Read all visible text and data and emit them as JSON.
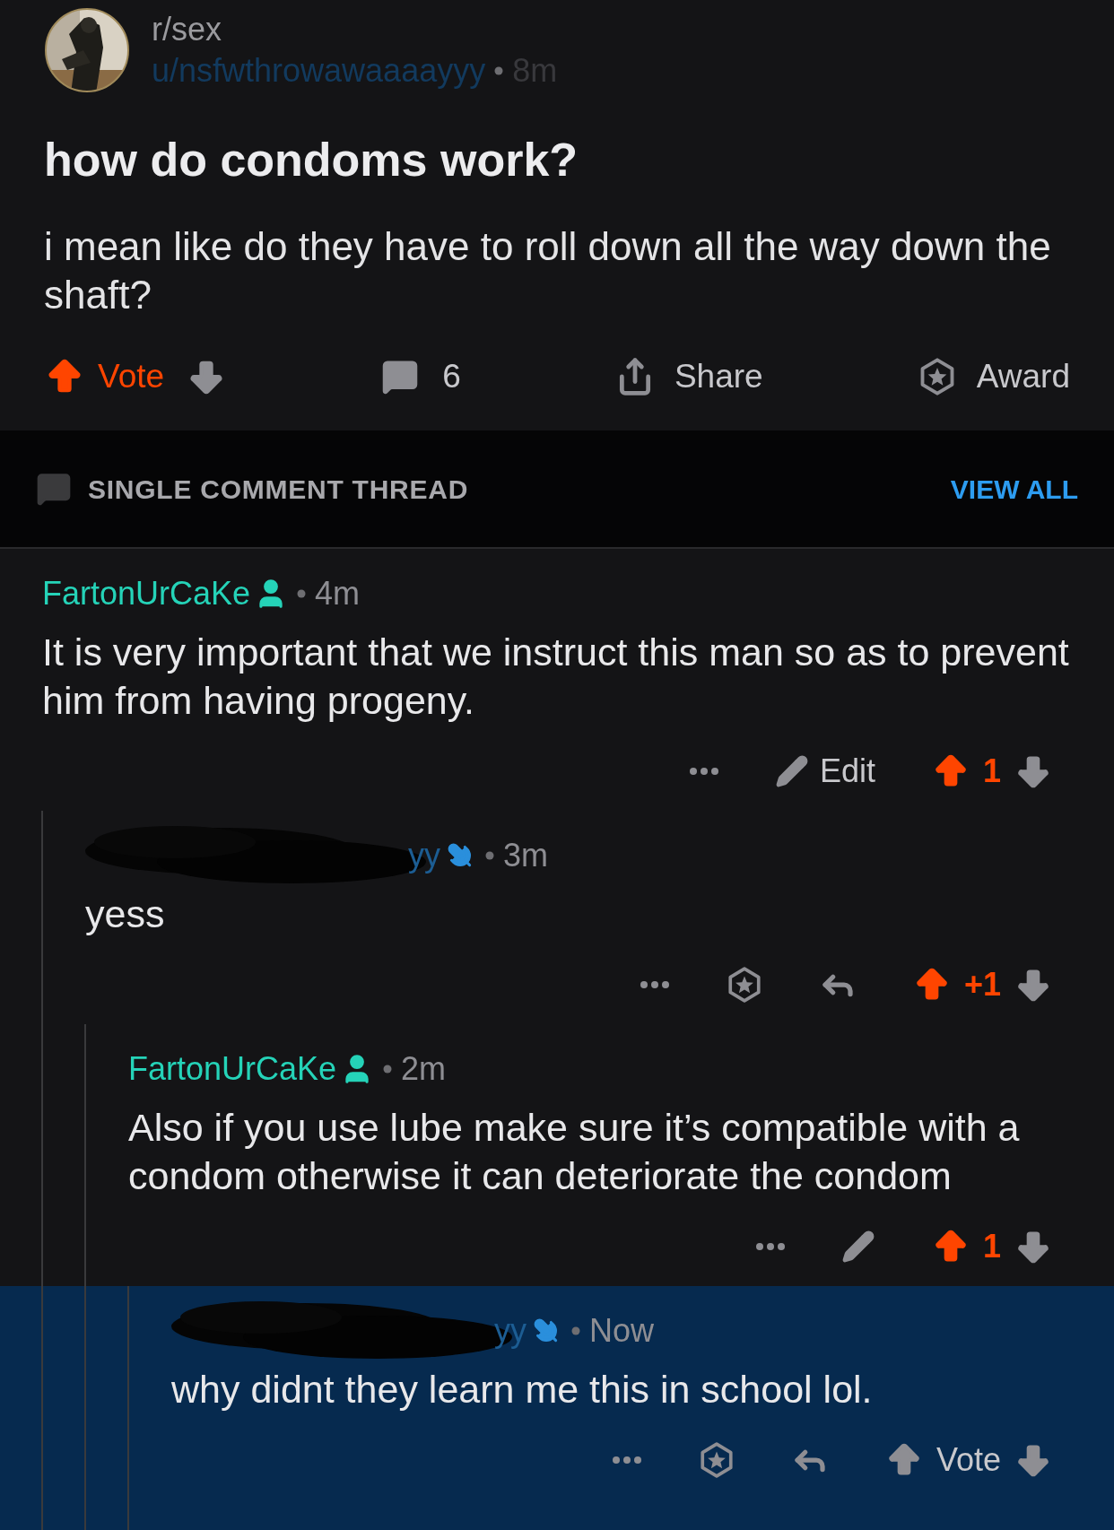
{
  "post": {
    "subreddit": "r/sex",
    "author": "u/nsfwthrowawaaaayyy",
    "age": "8m",
    "title": "how do condoms work?",
    "body": "i mean like do they have to roll down all the way down the shaft?",
    "vote": {
      "label": "Vote",
      "upvoted": true
    },
    "comments": "6",
    "share": "Share",
    "award": "Award"
  },
  "thread_header": {
    "label": "SINGLE COMMENT THREAD",
    "action": "VIEW ALL"
  },
  "comments": [
    {
      "author": {
        "name": "FartonUrCaKe",
        "redacted": false
      },
      "age": "4m",
      "body": "It is very important that we instruct this man so as to prevent him from having progeny.",
      "kind": "own",
      "edit_label": "Edit",
      "vote": {
        "label": "1",
        "upvoted": true
      },
      "highlighted": false,
      "children": [
        {
          "author": {
            "name": "yy",
            "redacted": true
          },
          "age": "3m",
          "body": "yess",
          "kind": "other",
          "vote": {
            "label": "+1",
            "upvoted": true
          },
          "highlighted": false,
          "children": [
            {
              "author": {
                "name": "FartonUrCaKe",
                "redacted": false
              },
              "age": "2m",
              "body": "Also if you use lube make sure it’s compatible with a condom otherwise it can deteriorate the condom",
              "kind": "own",
              "vote": {
                "label": "1",
                "upvoted": true
              },
              "highlighted": false,
              "children": [
                {
                  "author": {
                    "name": "yy",
                    "redacted": true
                  },
                  "age": "Now",
                  "body": "why didnt they learn me this in school lol.",
                  "kind": "other",
                  "vote": {
                    "label": "Vote",
                    "upvoted": false
                  },
                  "highlighted": true
                }
              ]
            }
          ]
        }
      ]
    }
  ]
}
